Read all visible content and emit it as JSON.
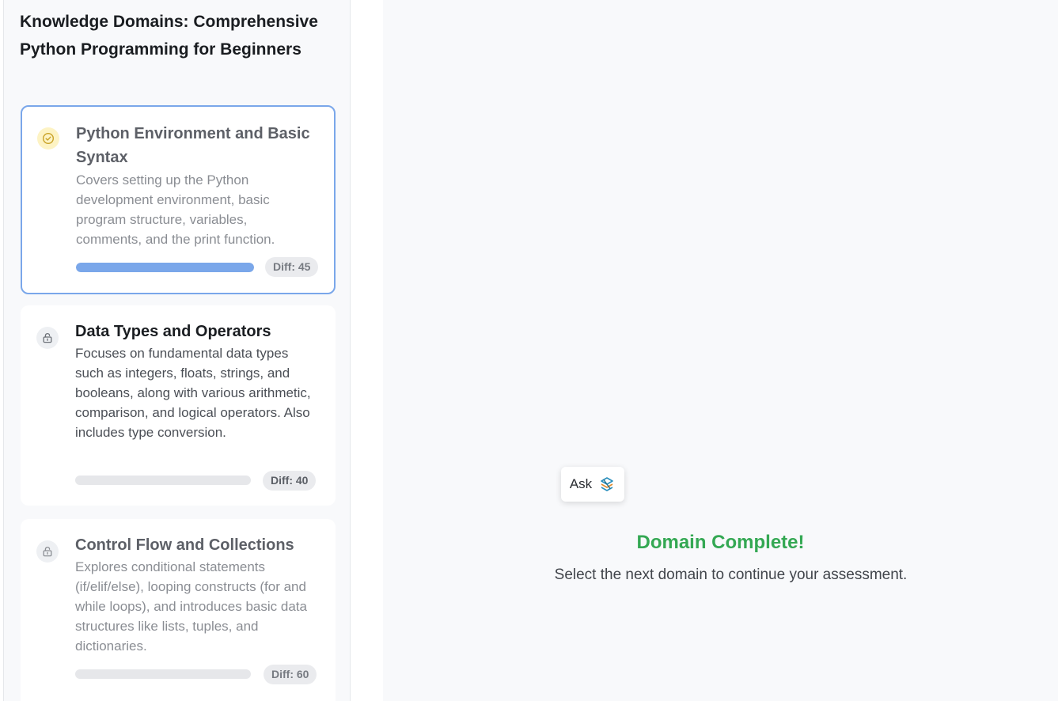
{
  "sidebar": {
    "title": "Knowledge Domains: Comprehensive Python Programming for Beginners",
    "domains": [
      {
        "title": "Python Environment and Basic Syntax",
        "description": "Covers setting up the Python development environment, basic program structure, variables, comments, and the print function.",
        "difficulty": "Diff: 45",
        "status_icon": "check-circle-icon",
        "progress": 1.0,
        "selected": true
      },
      {
        "title": "Data Types and Operators",
        "description": "Focuses on fundamental data types such as integers, floats, strings, and booleans, along with various arithmetic, comparison, and logical operators. Also includes type conversion.",
        "difficulty": "Diff: 40",
        "status_icon": "lock-icon",
        "progress": 0.0,
        "selected": false
      },
      {
        "title": "Control Flow and Collections",
        "description": "Explores conditional statements (if/elif/else), looping constructs (for and while loops), and introduces basic data structures like lists, tuples, and dictionaries.",
        "difficulty": "Diff: 60",
        "status_icon": "lock-icon",
        "progress": 0.0,
        "selected": false
      }
    ]
  },
  "ask_chip": {
    "label": "Ask",
    "icon": "stack-logo-icon"
  },
  "main": {
    "status_title": "Domain Complete!",
    "status_message": "Select the next domain to continue your assessment."
  },
  "colors": {
    "accent": "#7aa7ea",
    "success": "#34a853",
    "check_badge_bg": "#fdf3c4",
    "check_badge_fg": "#c9a227"
  }
}
